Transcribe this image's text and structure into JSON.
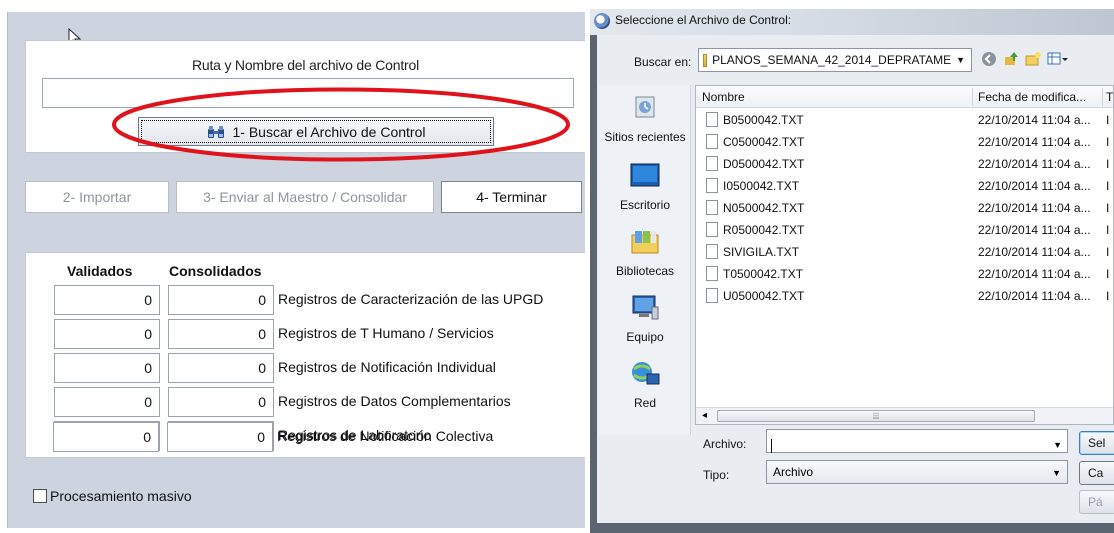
{
  "left_panel": {
    "control_title": "Ruta y Nombre del archivo de Control",
    "control_path_value": "",
    "buscar_button": "1- Buscar el Archivo de Control",
    "importar_button": "2- Importar",
    "enviar_button": "3- Enviar al Maestro / Consolidar",
    "terminar_button": "4- Terminar",
    "col_validados": "Validados",
    "col_consolidados": "Consolidados",
    "registros": [
      {
        "validados": "0",
        "consolidados": "0",
        "label": "Registros de Caracterización de las UPGD"
      },
      {
        "validados": "0",
        "consolidados": "0",
        "label": "Registros de T Humano / Servicios"
      },
      {
        "validados": "0",
        "consolidados": "0",
        "label": "Registros de Notificación Individual"
      },
      {
        "validados": "0",
        "consolidados": "0",
        "label": "Registros de Datos Complementarios"
      },
      {
        "validados": "0",
        "consolidados": "0",
        "label": "Registros de Laboratorio"
      },
      {
        "validados": "0",
        "consolidados": "0",
        "label": "Registros de Notificación Colectiva"
      }
    ],
    "masivo_label": "Procesamiento masivo",
    "masivo_checked": false,
    "highlight_color": "#e0131d"
  },
  "dialog": {
    "title": "Seleccione el Archivo de Control:",
    "buscar_en_label": "Buscar en:",
    "folder_name": "PLANOS_SEMANA_42_2014_DEPRATAME",
    "places": [
      {
        "label": "Sitios recientes",
        "icon": "recent-places-icon"
      },
      {
        "label": "Escritorio",
        "icon": "desktop-icon"
      },
      {
        "label": "Bibliotecas",
        "icon": "libraries-icon"
      },
      {
        "label": "Equipo",
        "icon": "computer-icon"
      },
      {
        "label": "Red",
        "icon": "network-icon"
      }
    ],
    "columns": {
      "nombre": "Nombre",
      "fecha": "Fecha de modifica...",
      "tipo": "T"
    },
    "files": [
      {
        "name": "B0500042.TXT",
        "date": "22/10/2014 11:04 a...",
        "cut": "I"
      },
      {
        "name": "C0500042.TXT",
        "date": "22/10/2014 11:04 a...",
        "cut": "I"
      },
      {
        "name": "D0500042.TXT",
        "date": "22/10/2014 11:04 a...",
        "cut": "I"
      },
      {
        "name": "I0500042.TXT",
        "date": "22/10/2014 11:04 a...",
        "cut": "I"
      },
      {
        "name": "N0500042.TXT",
        "date": "22/10/2014 11:04 a...",
        "cut": "I"
      },
      {
        "name": "R0500042.TXT",
        "date": "22/10/2014 11:04 a...",
        "cut": "I"
      },
      {
        "name": "SIVIGILA.TXT",
        "date": "22/10/2014 11:04 a...",
        "cut": "I"
      },
      {
        "name": "T0500042.TXT",
        "date": "22/10/2014 11:04 a...",
        "cut": "I"
      },
      {
        "name": "U0500042.TXT",
        "date": "22/10/2014 11:04 a...",
        "cut": "I"
      }
    ],
    "archivo_label": "Archivo:",
    "archivo_value": "",
    "tipo_label": "Tipo:",
    "tipo_value": "Archivo",
    "btn_seleccionar": "Sel",
    "btn_cancelar": "Ca",
    "btn_pagina": "Pá"
  }
}
